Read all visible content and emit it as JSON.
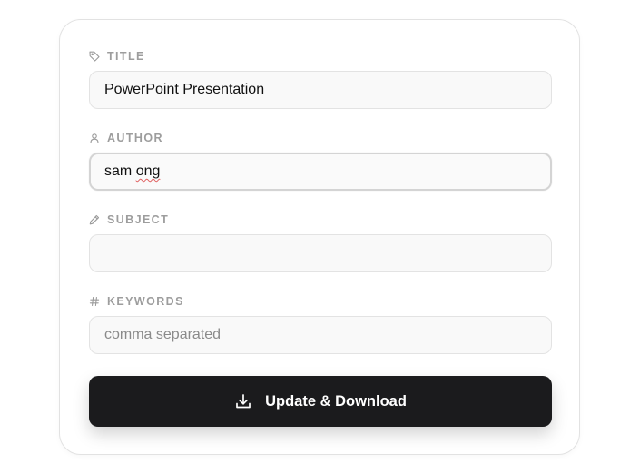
{
  "form": {
    "title": {
      "label": "TITLE",
      "icon": "tag-icon",
      "value": "PowerPoint Presentation"
    },
    "author": {
      "label": "AUTHOR",
      "icon": "user-icon",
      "value_word1": "sam",
      "value_word2": "ong"
    },
    "subject": {
      "label": "SUBJECT",
      "icon": "pencil-icon",
      "value": ""
    },
    "keywords": {
      "label": "KEYWORDS",
      "icon": "hash-icon",
      "value": "",
      "placeholder": "comma separated"
    },
    "submit": {
      "label": "Update & Download",
      "icon": "download-icon"
    }
  },
  "colors": {
    "button_bg": "#1b1b1d",
    "label": "#9d9d9d",
    "input_bg": "#f9f9f9",
    "spell_error": "#e06060"
  }
}
